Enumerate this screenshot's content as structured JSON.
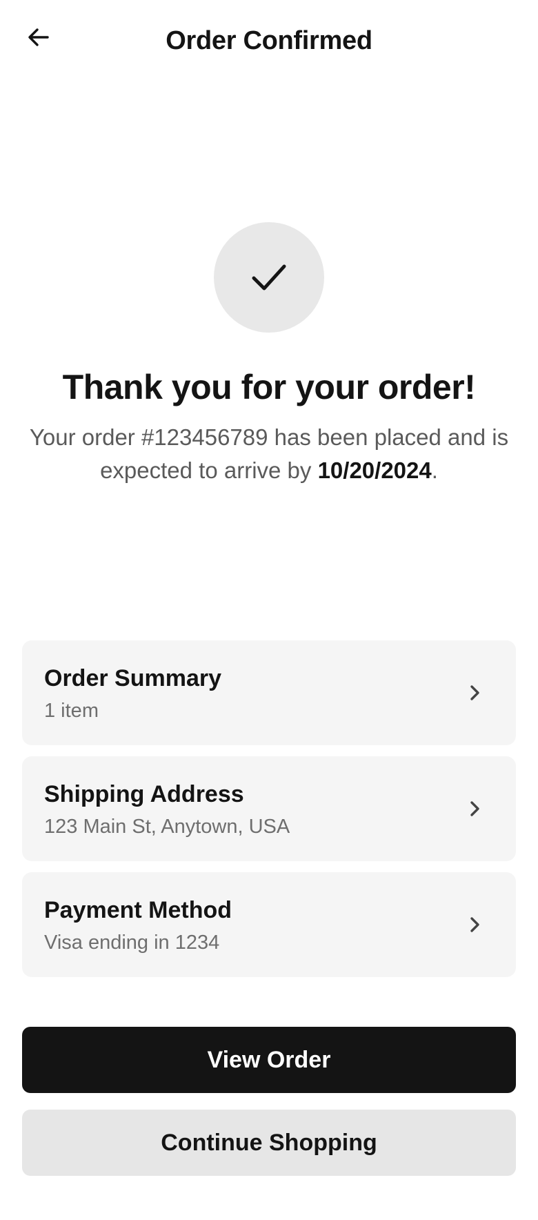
{
  "header": {
    "title": "Order Confirmed",
    "back_icon": "arrow-left-icon"
  },
  "confirmation": {
    "icon": "checkmark-icon",
    "heading": "Thank you for your order!",
    "message_prefix": "Your order #123456789 has been placed and is expected to arrive by ",
    "delivery_date": "10/20/2024",
    "message_suffix": "."
  },
  "cards": [
    {
      "title": "Order Summary",
      "subtitle": "1 item",
      "icon": "chevron-right-icon"
    },
    {
      "title": "Shipping Address",
      "subtitle": "123 Main St, Anytown, USA",
      "icon": "chevron-right-icon"
    },
    {
      "title": "Payment Method",
      "subtitle": "Visa ending in 1234",
      "icon": "chevron-right-icon"
    }
  ],
  "actions": {
    "primary_label": "View Order",
    "secondary_label": "Continue Shopping"
  },
  "colors": {
    "primary": "#141414",
    "card_background": "#f5f5f5",
    "check_circle": "#e8e8e8",
    "secondary_button": "#e6e6e6"
  }
}
